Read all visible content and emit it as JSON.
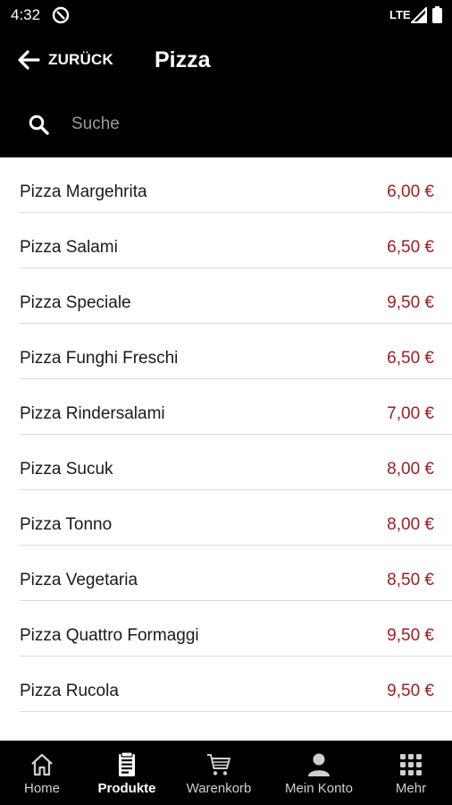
{
  "status_bar": {
    "time": "4:32",
    "network": "LTE"
  },
  "header": {
    "back_label": "ZURÜCK",
    "title": "Pizza"
  },
  "search": {
    "placeholder": "Suche",
    "value": ""
  },
  "products": [
    {
      "name": "Pizza Margehrita",
      "price": "6,00 €"
    },
    {
      "name": "Pizza Salami",
      "price": "6,50 €"
    },
    {
      "name": "Pizza Speciale",
      "price": "9,50 €"
    },
    {
      "name": "Pizza Funghi Freschi",
      "price": "6,50 €"
    },
    {
      "name": "Pizza Rindersalami",
      "price": "7,00 €"
    },
    {
      "name": "Pizza Sucuk",
      "price": "8,00 €"
    },
    {
      "name": "Pizza Tonno",
      "price": "8,00 €"
    },
    {
      "name": "Pizza Vegetaria",
      "price": "8,50 €"
    },
    {
      "name": "Pizza Quattro Formaggi",
      "price": "9,50 €"
    },
    {
      "name": "Pizza Rucola",
      "price": "9,50 €"
    }
  ],
  "bottom_nav": [
    {
      "label": "Home",
      "icon": "home-icon",
      "active": false
    },
    {
      "label": "Produkte",
      "icon": "products-icon",
      "active": true
    },
    {
      "label": "Warenkorb",
      "icon": "cart-icon",
      "active": false
    },
    {
      "label": "Mein Konto",
      "icon": "account-icon",
      "active": false
    },
    {
      "label": "Mehr",
      "icon": "more-grid-icon",
      "active": false
    }
  ],
  "colors": {
    "bar_background": "#000000",
    "price": "#a01d24",
    "divider": "#dcdcdc"
  }
}
